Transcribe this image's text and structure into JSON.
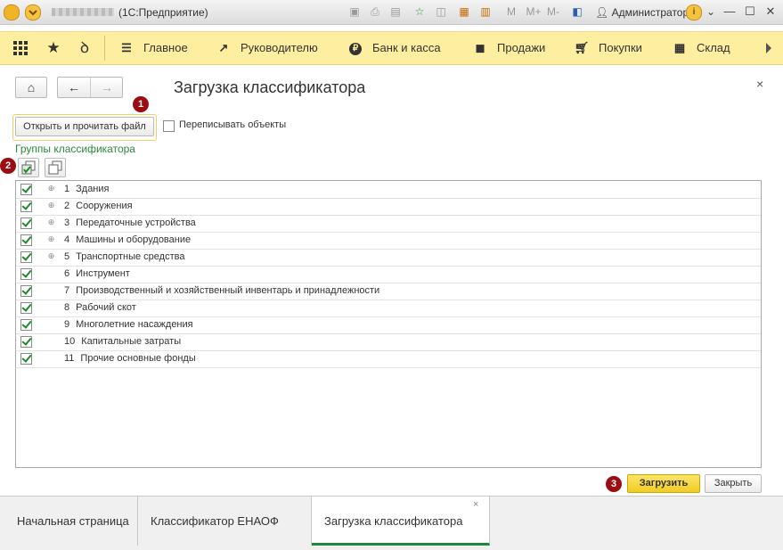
{
  "titlebar": {
    "title": "(1С:Предприятие)",
    "user": "Администратор",
    "m_labels": [
      "M",
      "M+",
      "M-"
    ]
  },
  "nav": {
    "items": [
      {
        "label": "Главное",
        "icon": "hamburger-icon"
      },
      {
        "label": "Руководителю",
        "icon": "trend-icon"
      },
      {
        "label": "Банк и касса",
        "icon": "ruble-icon"
      },
      {
        "label": "Продажи",
        "icon": "bag-icon"
      },
      {
        "label": "Покупки",
        "icon": "cart-icon"
      },
      {
        "label": "Склад",
        "icon": "grid-icon"
      }
    ]
  },
  "form": {
    "title": "Загрузка классификатора",
    "open_button": "Открыть и прочитать файл",
    "overwrite_label": "Переписывать объекты",
    "groups_title": "Группы классификатора",
    "load_button": "Загрузить",
    "close_button": "Закрыть",
    "badges": [
      "1",
      "2",
      "3"
    ]
  },
  "groups": [
    {
      "code": "1",
      "name": "Здания",
      "expandable": true,
      "checked": true
    },
    {
      "code": "2",
      "name": "Сооружения",
      "expandable": true,
      "checked": true
    },
    {
      "code": "3",
      "name": "Передаточные устройства",
      "expandable": true,
      "checked": true
    },
    {
      "code": "4",
      "name": "Машины и оборудование",
      "expandable": true,
      "checked": true
    },
    {
      "code": "5",
      "name": "Транспортные средства",
      "expandable": true,
      "checked": true
    },
    {
      "code": "6",
      "name": "Инструмент",
      "expandable": false,
      "checked": true
    },
    {
      "code": "7",
      "name": "Производственный и хозяйственный инвентарь и принадлежности",
      "expandable": false,
      "checked": true
    },
    {
      "code": "8",
      "name": "Рабочий скот",
      "expandable": false,
      "checked": true
    },
    {
      "code": "9",
      "name": "Многолетние насаждения",
      "expandable": false,
      "checked": true
    },
    {
      "code": "10",
      "name": "Капитальные затраты",
      "expandable": false,
      "checked": true
    },
    {
      "code": "11",
      "name": "Прочие основные фонды",
      "expandable": false,
      "checked": true
    }
  ],
  "tabs": [
    {
      "label": "Начальная страница"
    },
    {
      "label": "Классификатор ЕНАОФ"
    },
    {
      "label": "Загрузка классификатора",
      "active": true
    }
  ],
  "colors": {
    "nav_bg": "#fdeea0",
    "load_button": "#f7d83a",
    "badge": "#9b0d12",
    "check": "#1a8a2a",
    "groups_title": "#2a8a3a",
    "active_tab_underline": "#1d8a3a"
  }
}
